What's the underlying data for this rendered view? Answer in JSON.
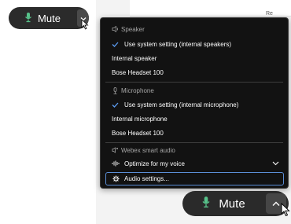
{
  "toolbar_top": {
    "mute_label": "Mute"
  },
  "toolbar_bottom": {
    "mute_label": "Mute"
  },
  "background": {
    "partial_text": "Re"
  },
  "audio_menu": {
    "speaker": {
      "heading": "Speaker",
      "options": [
        {
          "label": "Use system setting (internal speakers)",
          "selected": true
        },
        {
          "label": "Internal speaker",
          "selected": false
        },
        {
          "label": "Bose Headset 100",
          "selected": false
        }
      ]
    },
    "microphone": {
      "heading": "Microphone",
      "options": [
        {
          "label": "Use system setting (internal microphone)",
          "selected": true
        },
        {
          "label": "Internal microphone",
          "selected": false
        },
        {
          "label": "Bose Headset 100",
          "selected": false
        }
      ]
    },
    "smart_audio": {
      "heading": "Webex smart audio",
      "selected_label": "Optimize for my voice"
    },
    "audio_settings_label": "Audio settings..."
  },
  "colors": {
    "menu_bg": "#121212",
    "pill_bg": "#2b2b2b",
    "check": "#5b9bf0",
    "mic_green": "#57c28a",
    "focus_border": "#5b8ed6"
  },
  "icons": {
    "mic": "microphone-icon",
    "chevron_down": "chevron-down-icon",
    "chevron_up": "chevron-up-icon",
    "speaker": "speaker-icon",
    "check": "checkmark-icon",
    "smart_audio": "smart-audio-icon",
    "voice": "voice-waveform-icon",
    "gear": "gear-icon",
    "cursor": "mouse-pointer-icon"
  }
}
